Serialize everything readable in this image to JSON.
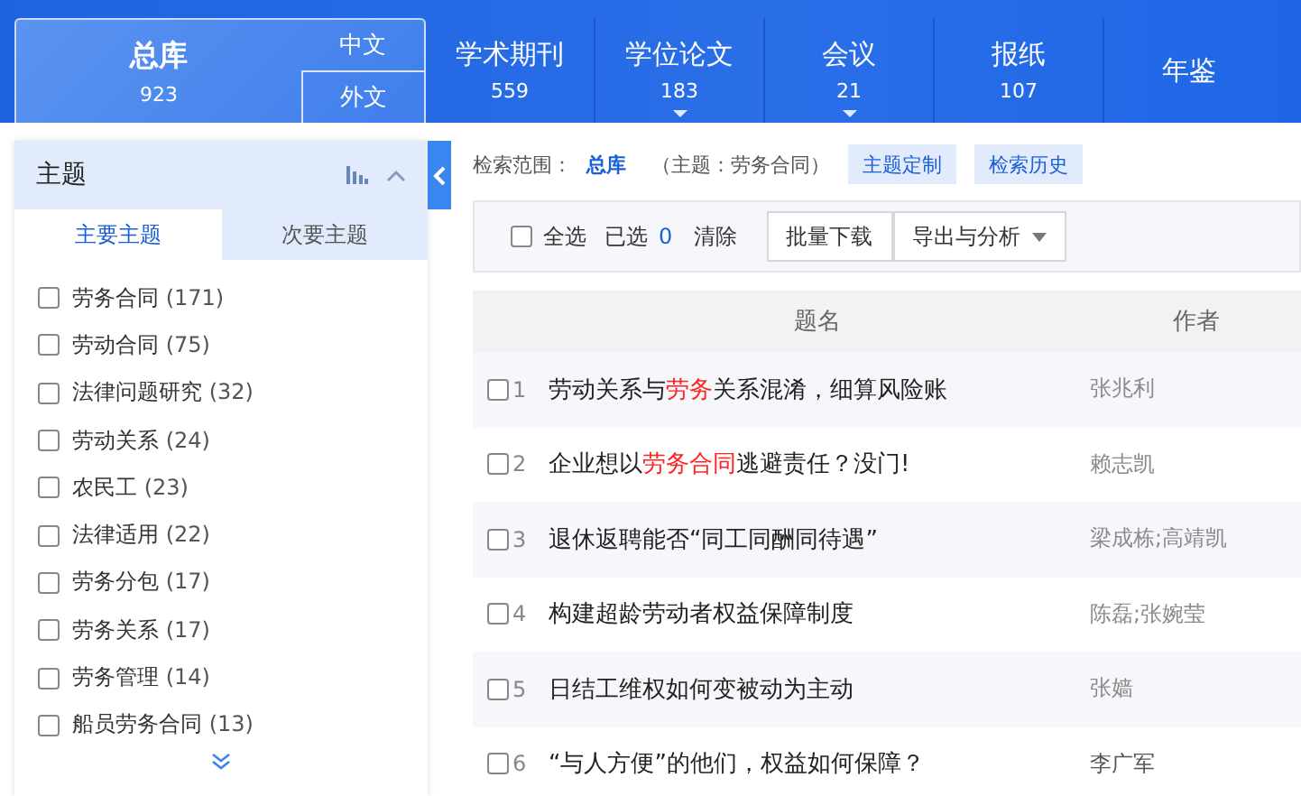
{
  "db_tabs": [
    {
      "label": "总库",
      "count": "923",
      "selected": true,
      "kind": "main",
      "subs": [
        "中文",
        "外文"
      ]
    },
    {
      "label": "学术期刊",
      "count": "559",
      "selected": false,
      "kind": "plain",
      "caret": false
    },
    {
      "label": "学位论文",
      "count": "183",
      "selected": false,
      "kind": "plain",
      "caret": true
    },
    {
      "label": "会议",
      "count": "21",
      "selected": false,
      "kind": "plain",
      "caret": true
    },
    {
      "label": "报纸",
      "count": "107",
      "selected": false,
      "kind": "plain",
      "caret": false
    },
    {
      "label": "年鉴",
      "selected": false,
      "kind": "plain",
      "caret": false
    }
  ],
  "facet": {
    "title": "主题",
    "tabs": [
      {
        "label": "主要主题",
        "selected": true
      },
      {
        "label": "次要主题",
        "selected": false
      }
    ],
    "items": [
      {
        "label": "劳务合同",
        "count": "(171)",
        "checked": false
      },
      {
        "label": "劳动合同",
        "count": "(75)",
        "checked": false
      },
      {
        "label": "法律问题研究",
        "count": "(32)",
        "checked": false
      },
      {
        "label": "劳动关系",
        "count": "(24)",
        "checked": false
      },
      {
        "label": "农民工",
        "count": "(23)",
        "checked": false
      },
      {
        "label": "法律适用",
        "count": "(22)",
        "checked": false
      },
      {
        "label": "劳务分包",
        "count": "(17)",
        "checked": false
      },
      {
        "label": "劳务关系",
        "count": "(17)",
        "checked": false
      },
      {
        "label": "劳务管理",
        "count": "(14)",
        "checked": false
      },
      {
        "label": "船员劳务合同",
        "count": "(13)",
        "checked": false
      }
    ]
  },
  "scope": {
    "label": "检索范围：",
    "value": "总库",
    "query": "（主题：劳务合同）",
    "buttons": [
      "主题定制",
      "检索历史"
    ]
  },
  "toolbar": {
    "select_all": {
      "label": "全选",
      "checked": false
    },
    "selected_label": "已选",
    "selected_count": "0",
    "clear": "清除",
    "buttons": [
      {
        "label": "批量下载",
        "caret": false
      },
      {
        "label": "导出与分析",
        "caret": true
      }
    ]
  },
  "table": {
    "columns": [
      "题名",
      "作者"
    ],
    "rows": [
      {
        "index": "1",
        "checked": false,
        "title": [
          {
            "text": "劳动关系与",
            "hit": false
          },
          {
            "text": "劳务",
            "hit": true
          },
          {
            "text": "关系混淆，细算风险账",
            "hit": false
          }
        ],
        "author": "张兆利"
      },
      {
        "index": "2",
        "checked": false,
        "title": [
          {
            "text": "企业想以",
            "hit": false
          },
          {
            "text": "劳务合同",
            "hit": true
          },
          {
            "text": "逃避责任？没门!",
            "hit": false
          }
        ],
        "author": "赖志凯"
      },
      {
        "index": "3",
        "checked": false,
        "title": [
          {
            "text": "退休返聘能否“同工同酬同待遇”",
            "hit": false
          }
        ],
        "author": "梁成栋;高靖凯"
      },
      {
        "index": "4",
        "checked": false,
        "title": [
          {
            "text": "构建超龄劳动者权益保障制度",
            "hit": false
          }
        ],
        "author": "陈磊;张婉莹"
      },
      {
        "index": "5",
        "checked": false,
        "title": [
          {
            "text": "日结工维权如何变被动为主动",
            "hit": false
          }
        ],
        "author": "张嫱"
      },
      {
        "index": "6",
        "checked": false,
        "title": [
          {
            "text": "“与人方便”的他们，权益如何保障？",
            "hit": false
          }
        ],
        "author": "李广军"
      }
    ]
  }
}
